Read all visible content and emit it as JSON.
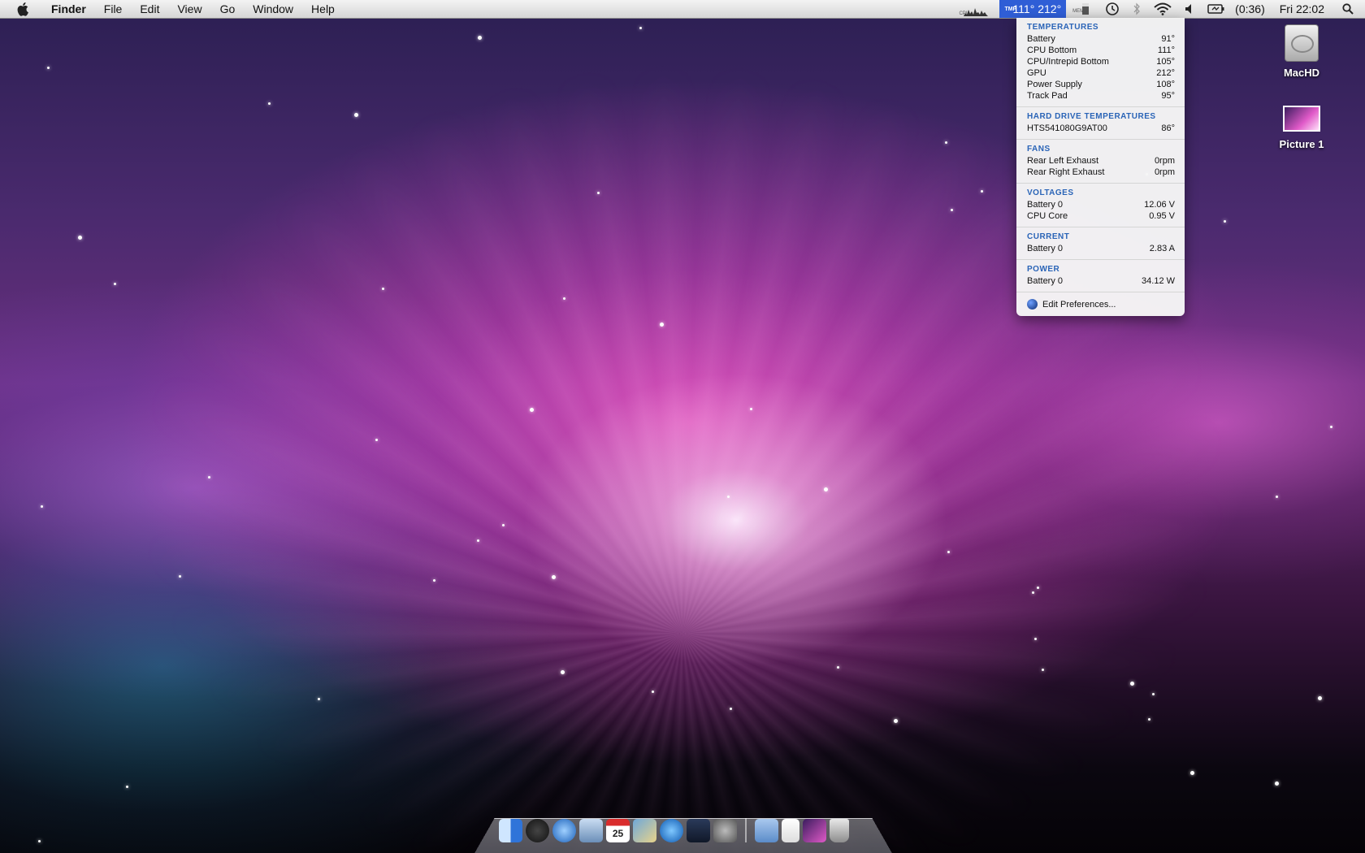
{
  "menubar": {
    "app": "Finder",
    "items": [
      "File",
      "Edit",
      "View",
      "Go",
      "Window",
      "Help"
    ],
    "status": {
      "cpu_label": "CPU",
      "temp_label": "TMP",
      "temp_values": "111° 212°",
      "mem_label": "MEM",
      "battery_time": "(0:36)",
      "clock": "Fri 22:02"
    }
  },
  "dropdown": {
    "sections": [
      {
        "heading": "TEMPERATURES",
        "rows": [
          {
            "label": "Battery",
            "value": "91°"
          },
          {
            "label": "CPU Bottom",
            "value": "111°"
          },
          {
            "label": "CPU/Intrepid Bottom",
            "value": "105°"
          },
          {
            "label": "GPU",
            "value": "212°"
          },
          {
            "label": "Power Supply",
            "value": "108°"
          },
          {
            "label": "Track Pad",
            "value": "95°"
          }
        ]
      },
      {
        "heading": "HARD DRIVE TEMPERATURES",
        "rows": [
          {
            "label": "HTS541080G9AT00",
            "value": "86°"
          }
        ]
      },
      {
        "heading": "FANS",
        "rows": [
          {
            "label": "Rear Left Exhaust",
            "value": "0rpm"
          },
          {
            "label": "Rear Right Exhaust",
            "value": "0rpm"
          }
        ]
      },
      {
        "heading": "VOLTAGES",
        "rows": [
          {
            "label": "Battery 0",
            "value": "12.06 V"
          },
          {
            "label": "CPU Core",
            "value": "0.95 V"
          }
        ]
      },
      {
        "heading": "CURRENT",
        "rows": [
          {
            "label": "Battery 0",
            "value": "2.83 A"
          }
        ]
      },
      {
        "heading": "POWER",
        "rows": [
          {
            "label": "Battery 0",
            "value": "34.12 W"
          }
        ]
      }
    ],
    "prefs_label": "Edit Preferences..."
  },
  "desktop": {
    "icons": [
      {
        "label": "MacHD",
        "icon": "hard-drive-icon"
      },
      {
        "label": "Picture 1",
        "icon": "picture-icon"
      }
    ]
  },
  "dock": {
    "items": [
      "finder-icon",
      "dashboard-icon",
      "safari-icon",
      "mail-icon",
      "ical-icon",
      "iphoto-icon",
      "itunes-icon",
      "spaces-icon",
      "system-preferences-icon",
      "applications-folder-icon",
      "documents-icon",
      "picture-stack-icon",
      "trash-icon"
    ],
    "ical_day": "25"
  },
  "colors": {
    "accent": "#2f5ed6",
    "section_heading": "#2a64b7"
  }
}
